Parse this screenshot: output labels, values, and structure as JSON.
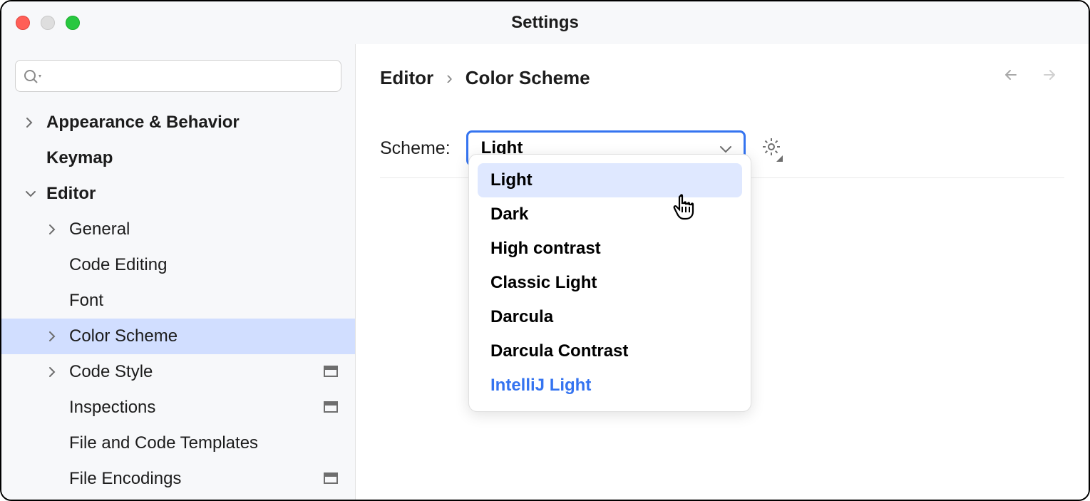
{
  "window": {
    "title": "Settings"
  },
  "sidebar": {
    "items": [
      {
        "label": "Appearance & Behavior",
        "level": 0,
        "arrow": "right",
        "bold": true
      },
      {
        "label": "Keymap",
        "level": 0,
        "arrow": "none",
        "bold": true
      },
      {
        "label": "Editor",
        "level": 0,
        "arrow": "down",
        "bold": true
      },
      {
        "label": "General",
        "level": 1,
        "arrow": "right"
      },
      {
        "label": "Code Editing",
        "level": 1,
        "arrow": "none"
      },
      {
        "label": "Font",
        "level": 1,
        "arrow": "none"
      },
      {
        "label": "Color Scheme",
        "level": 1,
        "arrow": "right",
        "selected": true
      },
      {
        "label": "Code Style",
        "level": 1,
        "arrow": "right",
        "tag": true
      },
      {
        "label": "Inspections",
        "level": 1,
        "arrow": "none",
        "tag": true
      },
      {
        "label": "File and Code Templates",
        "level": 1,
        "arrow": "none"
      },
      {
        "label": "File Encodings",
        "level": 1,
        "arrow": "none",
        "tag": true
      }
    ]
  },
  "breadcrumb": {
    "part1": "Editor",
    "sep": "›",
    "part2": "Color Scheme"
  },
  "scheme": {
    "label": "Scheme:",
    "selected": "Light",
    "options": [
      {
        "label": "Light",
        "hover": true
      },
      {
        "label": "Dark"
      },
      {
        "label": "High contrast"
      },
      {
        "label": "Classic Light"
      },
      {
        "label": "Darcula"
      },
      {
        "label": "Darcula Contrast"
      },
      {
        "label": "IntelliJ Light",
        "link": true
      }
    ]
  }
}
